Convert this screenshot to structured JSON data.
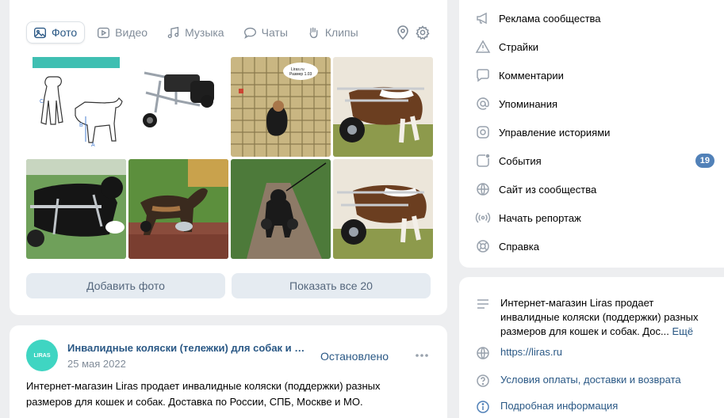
{
  "tabs": [
    {
      "label": "Фото",
      "icon": "photo-icon"
    },
    {
      "label": "Видео",
      "icon": "video-icon"
    },
    {
      "label": "Музыка",
      "icon": "music-icon"
    },
    {
      "label": "Чаты",
      "icon": "chats-icon"
    },
    {
      "label": "Клипы",
      "icon": "clips-icon"
    }
  ],
  "photos": {
    "add_label": "Добавить фото",
    "show_all_label": "Показать все 20",
    "items": [
      "dog-wheelchair-size-chart",
      "wheelchair-product",
      "dog-in-wheelchair-shopping-cart",
      "bulldog-in-wheelchair",
      "black-dog-in-wheelchair",
      "shepherd-in-wheelchair",
      "black-dog-on-path",
      "bulldog-in-wheelchair-2"
    ],
    "label_in_photo": "Liras.ru\nРазмер 1.03"
  },
  "post": {
    "author": "Инвалидные коляски (тележки) для собак и к...",
    "date": "25 мая 2022",
    "status": "Остановлено",
    "text": "Интернет-магазин Liras продает инвалидные коляски (поддержки) разных размеров для кошек и собак. Доставка по России, СПБ, Москве и МО.",
    "avatar_text": "LIRAS"
  },
  "menu": [
    {
      "label": "Реклама сообщества",
      "icon": "megaphone-icon"
    },
    {
      "label": "Страйки",
      "icon": "warning-icon"
    },
    {
      "label": "Комментарии",
      "icon": "comment-icon"
    },
    {
      "label": "Упоминания",
      "icon": "mention-icon"
    },
    {
      "label": "Управление историями",
      "icon": "stories-icon"
    },
    {
      "label": "События",
      "icon": "events-icon",
      "badge": "19"
    },
    {
      "label": "Сайт из сообщества",
      "icon": "globe-icon"
    },
    {
      "label": "Начать репортаж",
      "icon": "broadcast-icon"
    },
    {
      "label": "Справка",
      "icon": "help-icon"
    }
  ],
  "info": {
    "description": "Интернет-магазин Liras продает инвалидные коляски (поддержки) разных размеров для кошек и собак. Дос...",
    "more_label": "Ещё",
    "website": "https://liras.ru",
    "terms": "Условия оплаты, доставки и возврата",
    "details": "Подробная информация"
  },
  "colors": {
    "link": "#2a5885",
    "muted": "#818c99",
    "button_bg": "#e5ebf1",
    "badge": "#5181b8",
    "page_bg": "#edeef0"
  }
}
